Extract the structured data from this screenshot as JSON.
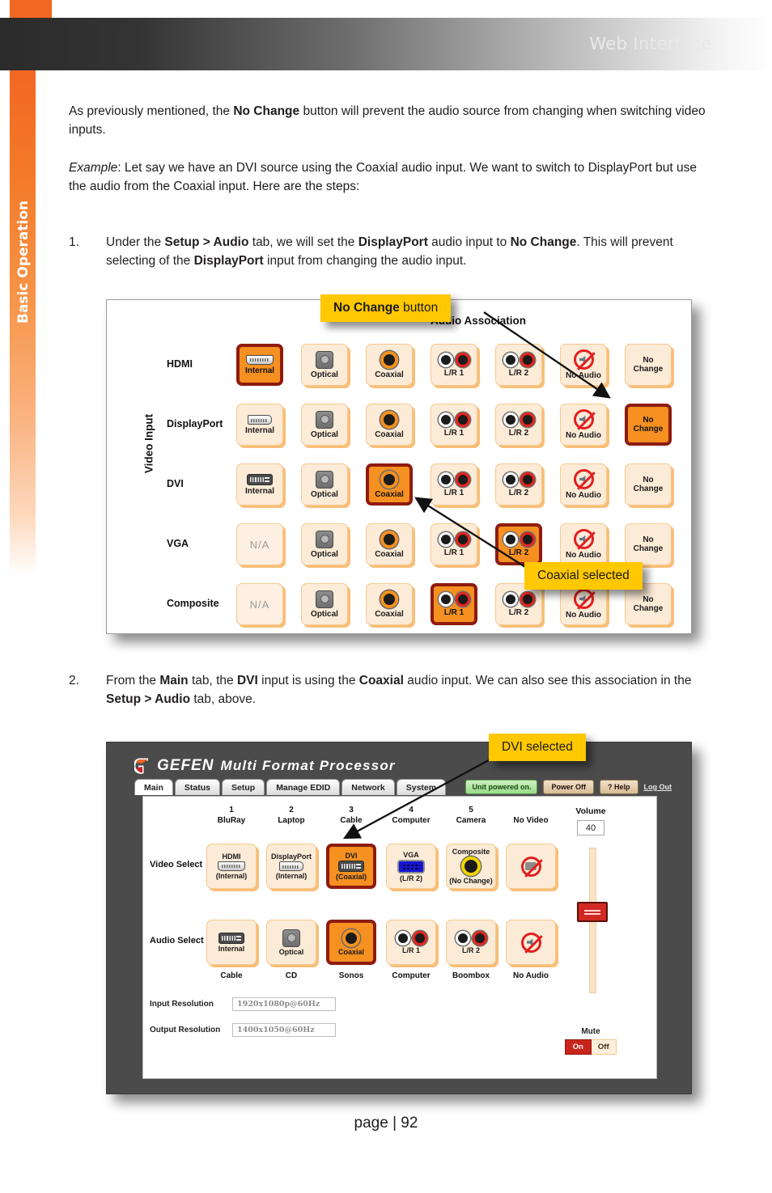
{
  "header": {
    "title": "Web Interface",
    "side_tab": "Basic Operation"
  },
  "body": {
    "p1_before": "As previously mentioned, the ",
    "p1_bold": "No Change",
    "p1_after": " button will prevent the audio source from changing when switching video inputs.",
    "p2_italic": "Example",
    "p2_rest": ":  Let say we have an DVI source using the Coaxial audio input.  We want to switch to DisplayPort but use the audio from the Coaxial input.  Here are the steps:",
    "step1_num": "1.",
    "step1_a": "Under the ",
    "step1_b1": "Setup > Audio",
    "step1_c": " tab, we will set the ",
    "step1_b2": "DisplayPort",
    "step1_d": " audio input to ",
    "step1_b3": "No Change",
    "step1_e": ". This will prevent selecting of the ",
    "step1_b4": "DisplayPort",
    "step1_f": " input from changing the audio input.",
    "step2_num": "2.",
    "step2_a": "From the ",
    "step2_b1": "Main",
    "step2_c": " tab, the ",
    "step2_b2": "DVI",
    "step2_d": " input is using the ",
    "step2_b3": "Coaxial",
    "step2_e": " audio input.  We can also see this association in the ",
    "step2_b4": "Setup > Audio",
    "step2_f": " tab, above."
  },
  "callouts": {
    "no_change_bold": "No Change",
    "no_change_rest": " button",
    "coaxial_selected": "Coaxial selected",
    "dvi_selected": "DVI selected"
  },
  "figure1": {
    "title": "Audio Association",
    "axis_label": "Video Input",
    "rows": [
      {
        "name": "HDMI",
        "cells": [
          {
            "label": "Internal",
            "icon": "hdmi-icon",
            "selected": true
          },
          {
            "label": "Optical",
            "icon": "optical-icon",
            "selected": false
          },
          {
            "label": "Coaxial",
            "icon": "coaxial-icon",
            "selected": false
          },
          {
            "label": "L/R 1",
            "icon": "rca-pair-icon",
            "selected": false
          },
          {
            "label": "L/R 2",
            "icon": "rca-pair-icon",
            "selected": false
          },
          {
            "label": "No Audio",
            "icon": "no-audio-icon",
            "selected": false
          },
          {
            "label": "No Change",
            "icon": "text-only",
            "selected": false
          }
        ]
      },
      {
        "name": "DisplayPort",
        "cells": [
          {
            "label": "Internal",
            "icon": "displayport-icon",
            "selected": false
          },
          {
            "label": "Optical",
            "icon": "optical-icon",
            "selected": false
          },
          {
            "label": "Coaxial",
            "icon": "coaxial-icon",
            "selected": false
          },
          {
            "label": "L/R 1",
            "icon": "rca-pair-icon",
            "selected": false
          },
          {
            "label": "L/R 2",
            "icon": "rca-pair-icon",
            "selected": false
          },
          {
            "label": "No Audio",
            "icon": "no-audio-icon",
            "selected": false
          },
          {
            "label": "No Change",
            "icon": "text-only",
            "selected": true
          }
        ]
      },
      {
        "name": "DVI",
        "cells": [
          {
            "label": "Internal",
            "icon": "dvi-icon",
            "selected": false
          },
          {
            "label": "Optical",
            "icon": "optical-icon",
            "selected": false
          },
          {
            "label": "Coaxial",
            "icon": "coaxial-icon",
            "selected": true
          },
          {
            "label": "L/R 1",
            "icon": "rca-pair-icon",
            "selected": false
          },
          {
            "label": "L/R 2",
            "icon": "rca-pair-icon",
            "selected": false
          },
          {
            "label": "No Audio",
            "icon": "no-audio-icon",
            "selected": false
          },
          {
            "label": "No Change",
            "icon": "text-only",
            "selected": false
          }
        ]
      },
      {
        "name": "VGA",
        "cells": [
          {
            "label": "N/A",
            "icon": "none",
            "selected": false
          },
          {
            "label": "Optical",
            "icon": "optical-icon",
            "selected": false
          },
          {
            "label": "Coaxial",
            "icon": "coaxial-icon",
            "selected": false
          },
          {
            "label": "L/R 1",
            "icon": "rca-pair-icon",
            "selected": false
          },
          {
            "label": "L/R 2",
            "icon": "rca-pair-icon",
            "selected": true
          },
          {
            "label": "No Audio",
            "icon": "no-audio-icon",
            "selected": false
          },
          {
            "label": "No Change",
            "icon": "text-only",
            "selected": false
          }
        ]
      },
      {
        "name": "Composite",
        "cells": [
          {
            "label": "N/A",
            "icon": "none",
            "selected": false
          },
          {
            "label": "Optical",
            "icon": "optical-icon",
            "selected": false
          },
          {
            "label": "Coaxial",
            "icon": "coaxial-icon",
            "selected": false
          },
          {
            "label": "L/R 1",
            "icon": "rca-pair-icon",
            "selected": true
          },
          {
            "label": "L/R 2",
            "icon": "rca-pair-icon",
            "selected": false
          },
          {
            "label": "No Audio",
            "icon": "no-audio-icon",
            "selected": false
          },
          {
            "label": "No Change",
            "icon": "text-only",
            "selected": false
          }
        ]
      }
    ]
  },
  "figure2": {
    "brand": "GEFEN",
    "product": "Multi Format Processor",
    "tabs": [
      "Main",
      "Status",
      "Setup",
      "Manage EDID",
      "Network",
      "System"
    ],
    "active_tab": "Main",
    "status": {
      "powered": "Unit powered on.",
      "power_off": "Power Off",
      "help": "?  Help",
      "logout": "Log Out"
    },
    "video_select_label": "Video Select",
    "audio_select_label": "Audio Select",
    "video_columns": [
      {
        "num": "1",
        "name": "BluRay",
        "port": "HDMI",
        "assoc": "(Internal)",
        "icon": "hdmi-icon",
        "selected": false
      },
      {
        "num": "2",
        "name": "Laptop",
        "port": "DisplayPort",
        "assoc": "(Internal)",
        "icon": "displayport-icon",
        "selected": false
      },
      {
        "num": "3",
        "name": "Cable",
        "port": "DVI",
        "assoc": "(Coaxial)",
        "icon": "dvi-icon",
        "selected": true
      },
      {
        "num": "4",
        "name": "Computer",
        "port": "VGA",
        "assoc": "(L/R 2)",
        "icon": "vga-icon",
        "selected": false
      },
      {
        "num": "5",
        "name": "Camera",
        "port": "Composite",
        "assoc": "(No Change)",
        "icon": "composite-icon",
        "selected": false
      },
      {
        "num": "",
        "name": "No Video",
        "port": "",
        "assoc": "",
        "icon": "no-video-icon",
        "selected": false
      }
    ],
    "audio_columns": [
      {
        "label": "Internal",
        "caption": "Cable",
        "icon": "dvi-icon",
        "selected": false
      },
      {
        "label": "Optical",
        "caption": "CD",
        "icon": "optical-icon",
        "selected": false
      },
      {
        "label": "Coaxial",
        "caption": "Sonos",
        "icon": "coaxial-icon",
        "selected": true
      },
      {
        "label": "L/R 1",
        "caption": "Computer",
        "icon": "rca-pair-icon",
        "selected": false
      },
      {
        "label": "L/R 2",
        "caption": "Boombox",
        "icon": "rca-pair-icon",
        "selected": false
      },
      {
        "label": "",
        "caption": "No Audio",
        "icon": "no-audio-icon",
        "selected": false
      }
    ],
    "input_resolution_label": "Input Resolution",
    "input_resolution_value": "1920x1080p@60Hz",
    "output_resolution_label": "Output Resolution",
    "output_resolution_value": "1400x1050@60Hz",
    "volume_label": "Volume",
    "volume_value": "40",
    "mute_label": "Mute",
    "mute_on": "On",
    "mute_off": "Off",
    "mute_state": "On"
  },
  "footer": {
    "page": "page | 92"
  },
  "colors": {
    "accent_orange": "#F26722",
    "selected_fill": "#F59021",
    "selected_border": "#8E1B0E",
    "callout_bg": "#FFC800"
  }
}
